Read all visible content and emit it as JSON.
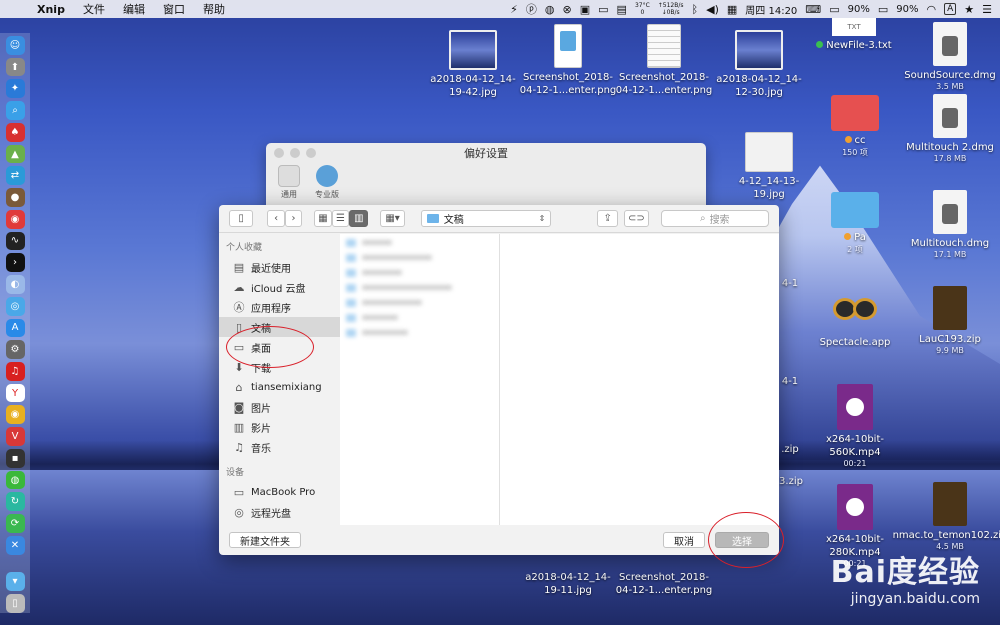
{
  "menubar": {
    "app_name": "Xnip",
    "menus": [
      "文件",
      "编辑",
      "窗口",
      "帮助"
    ],
    "temp_top": "37°C",
    "temp_bottom": "0",
    "net_up": "↑512B/s",
    "net_down": "↓0B/s",
    "clock": "周四 14:20",
    "battery1": "90%",
    "battery2": "90%",
    "input_method": "A"
  },
  "desktop": {
    "items": [
      {
        "label": "a2018-04-12_14-19-42.jpg",
        "kind": "landscape"
      },
      {
        "label": "Screenshot_2018-04-12-1...enter.png",
        "kind": "phone"
      },
      {
        "label": "Screenshot_2018-04-12-1...enter.png",
        "kind": "doc"
      },
      {
        "label": "a2018-04-12_14-12-30.jpg",
        "kind": "landscape"
      },
      {
        "label": "NewFile-3.txt",
        "kind": "txt"
      },
      {
        "label": "SoundSource.dmg",
        "kind": "file",
        "sub": "3.5 MB"
      },
      {
        "label": "cc",
        "kind": "folder-red",
        "sub": "150 项"
      },
      {
        "label": "Multitouch 2.dmg",
        "kind": "file",
        "sub": "17.8 MB"
      },
      {
        "label": "4-12_14-13-19.jpg",
        "kind": "landscape"
      },
      {
        "label": "Pa",
        "kind": "folder-blue",
        "sub": "2 项"
      },
      {
        "label": "Multitouch.dmg",
        "kind": "file",
        "sub": "17.1 MB"
      },
      {
        "label": "Spectacle.app",
        "kind": "glasses"
      },
      {
        "label": "LauC193.zip",
        "kind": "zip",
        "sub": "9.9 MB"
      },
      {
        "label": "x264-10bit-560K.mp4",
        "kind": "video",
        "sub": "00:21"
      },
      {
        "label": "x264-10bit-280K.mp4",
        "kind": "video",
        "sub": "00:21"
      },
      {
        "label": "nmac.to_temon102.zip",
        "kind": "zip",
        "sub": "4.5 MB"
      },
      {
        "label": "a2018-04-12_14-19-11.jpg",
        "kind": "none"
      },
      {
        "label": "Screenshot_2018-04-12-1...enter.png",
        "kind": "none"
      }
    ],
    "partial_labels": [
      "4-1",
      "4-1",
      ".zip",
      "3.zip"
    ],
    "txt_badge": "TXT"
  },
  "prefs_window": {
    "title": "偏好设置",
    "tabs": [
      {
        "label": "通用"
      },
      {
        "label": "专业版"
      }
    ]
  },
  "dialog": {
    "path": "文稿",
    "search_placeholder": "搜索",
    "favorites_header": "个人收藏",
    "favorites": [
      {
        "label": "最近使用",
        "icon": "recent-icon"
      },
      {
        "label": "iCloud 云盘",
        "icon": "cloud-icon"
      },
      {
        "label": "应用程序",
        "icon": "apps-icon"
      },
      {
        "label": "文稿",
        "icon": "document-icon",
        "selected": true
      },
      {
        "label": "桌面",
        "icon": "desktop-icon"
      },
      {
        "label": "下载",
        "icon": "download-icon"
      },
      {
        "label": "tiansemixiang",
        "icon": "home-icon"
      },
      {
        "label": "图片",
        "icon": "camera-icon"
      },
      {
        "label": "影片",
        "icon": "film-icon"
      },
      {
        "label": "音乐",
        "icon": "music-icon"
      }
    ],
    "devices_header": "设备",
    "devices": [
      {
        "label": "MacBook Pro",
        "icon": "laptop-icon"
      },
      {
        "label": "远程光盘",
        "icon": "disc-icon"
      }
    ],
    "new_folder": "新建文件夹",
    "cancel": "取消",
    "choose": "选择"
  },
  "watermark": {
    "brand": "Bai度经验",
    "url": "jingyan.baidu.com"
  },
  "colors": {
    "annotation_red": "#d9202a",
    "folder_blue": "#6db4ea"
  }
}
